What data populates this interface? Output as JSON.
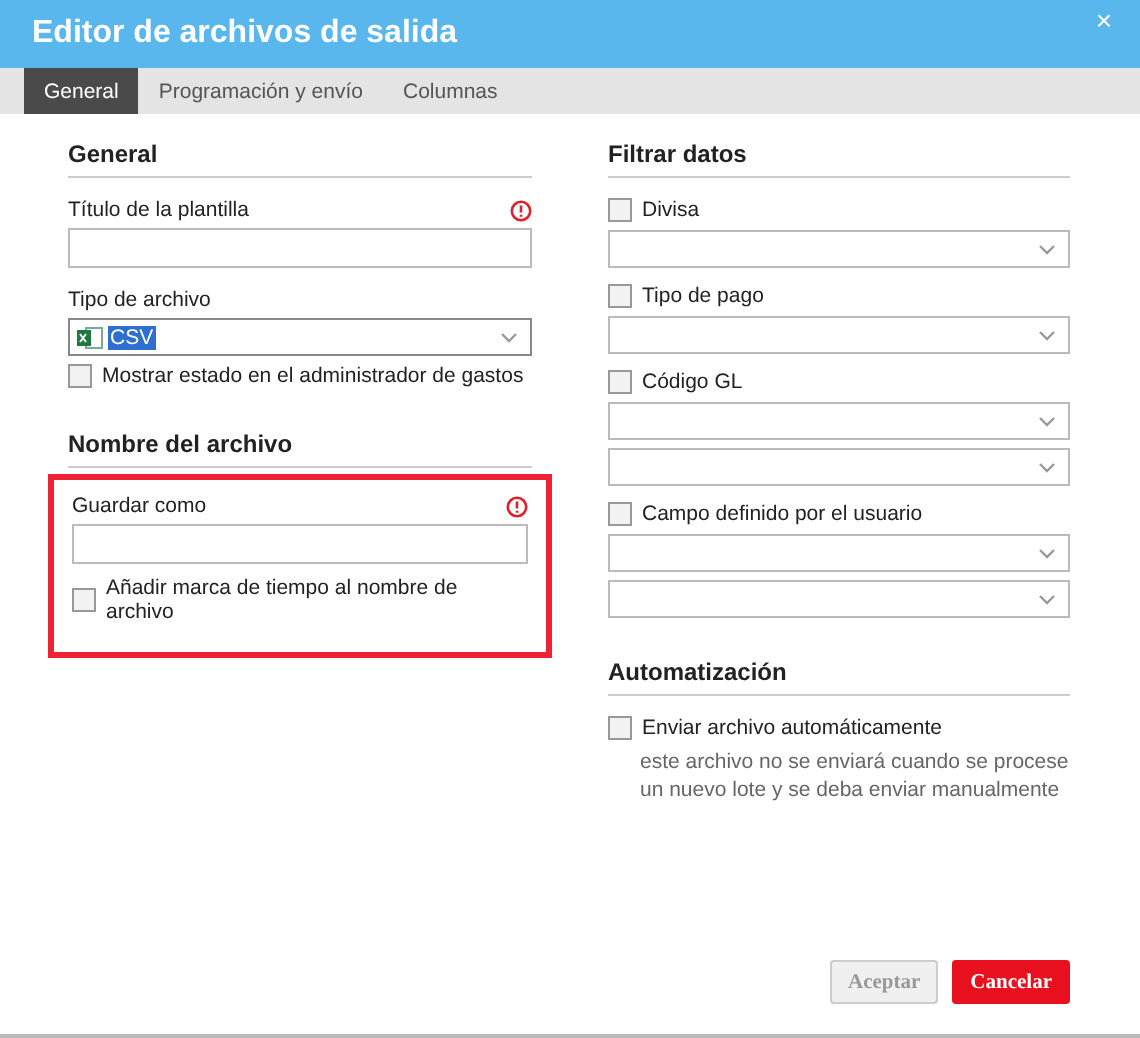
{
  "window": {
    "title": "Editor de archivos de salida",
    "close": "×"
  },
  "tabs": [
    {
      "label": "General",
      "selected": true
    },
    {
      "label": "Programación y envío",
      "selected": false
    },
    {
      "label": "Columnas",
      "selected": false
    }
  ],
  "general": {
    "heading": "General",
    "template_title": {
      "label": "Título de la plantilla",
      "required": true
    },
    "file_type": {
      "label": "Tipo de archivo",
      "value": "CSV",
      "value_selected": true
    },
    "show_status": {
      "label": "Mostrar estado en el administrador de gastos",
      "checked": false
    }
  },
  "file_name": {
    "heading": "Nombre del archivo",
    "highlighted": true,
    "save_as": {
      "label": "Guardar como",
      "required": true
    },
    "timestamp": {
      "label": "Añadir marca de tiempo al nombre de archivo",
      "checked": false
    }
  },
  "filter": {
    "heading": "Filtrar datos",
    "filters": [
      {
        "label": "Divisa",
        "checked": false,
        "kind": "single"
      },
      {
        "label": "Tipo de pago",
        "checked": false,
        "kind": "single"
      },
      {
        "label": "Código GL",
        "checked": false,
        "kind": "pair"
      },
      {
        "label": "Campo definido por el usuario",
        "checked": false,
        "kind": "pair"
      }
    ]
  },
  "automation": {
    "heading": "Automatización",
    "auto_send": {
      "label": "Enviar archivo automáticamente",
      "checked": false,
      "note": "este archivo no se enviará cuando se procese un nuevo lote y se deba enviar manualmente"
    }
  },
  "buttons": [
    {
      "label": "Aceptar",
      "kind": "secondary",
      "disabled": true
    },
    {
      "label": "Cancelar",
      "kind": "primary",
      "disabled": false
    }
  ]
}
